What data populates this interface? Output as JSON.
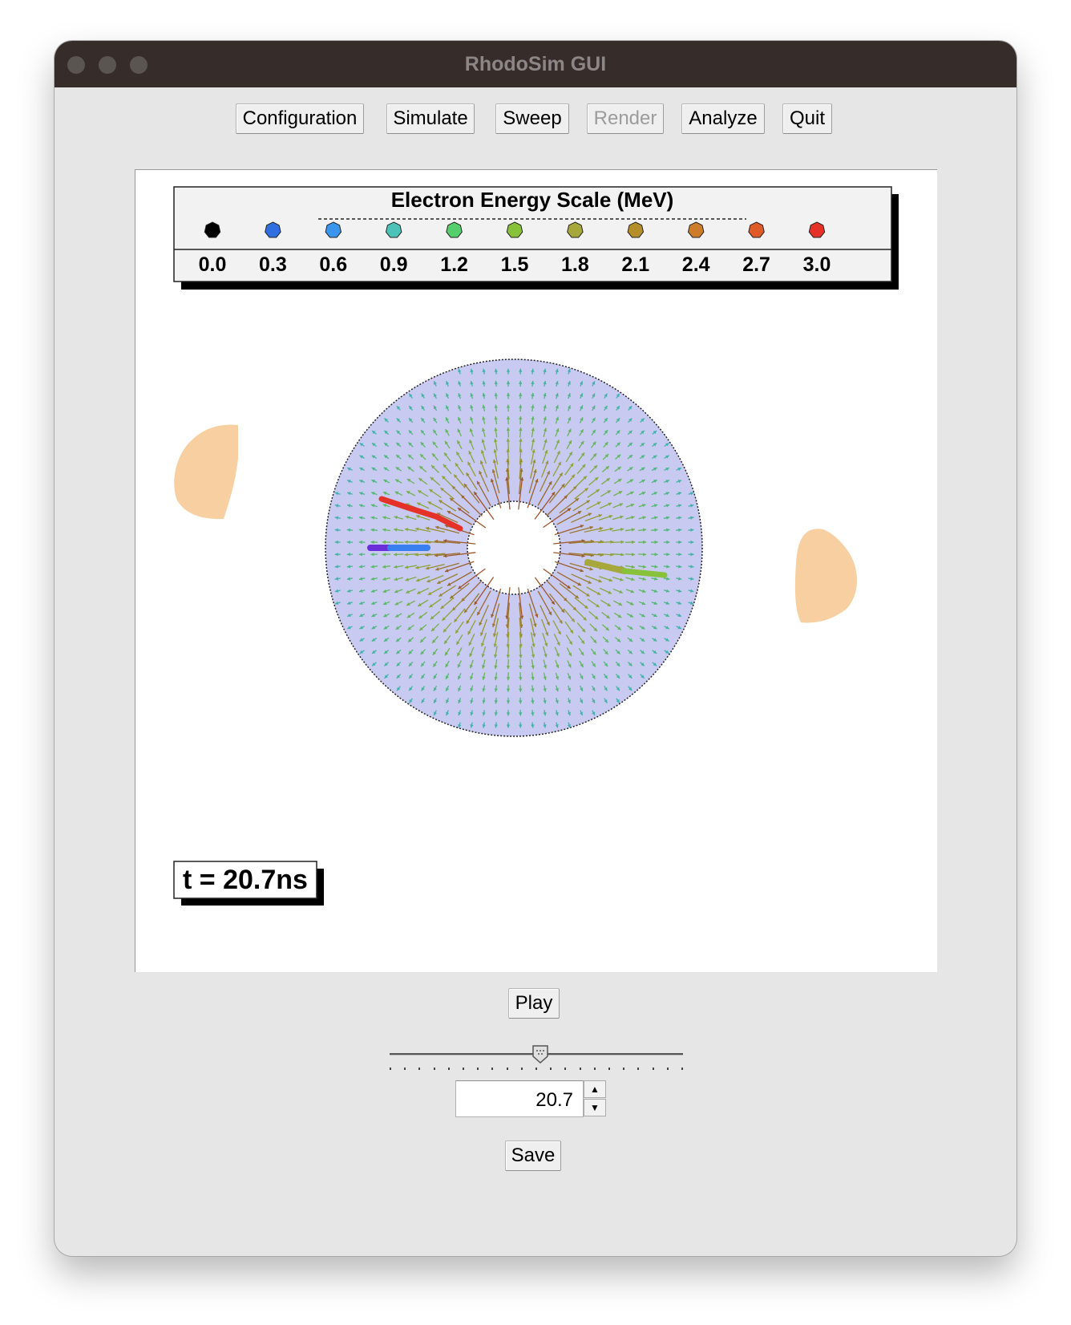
{
  "window": {
    "title": "RhodoSim GUI"
  },
  "toolbar": {
    "configuration": "Configuration",
    "simulate": "Simulate",
    "sweep": "Sweep",
    "render": "Render",
    "analyze": "Analyze",
    "quit": "Quit"
  },
  "legend": {
    "title": "Electron Energy Scale (MeV)",
    "items": [
      {
        "label": "0.0",
        "color": "#000000"
      },
      {
        "label": "0.3",
        "color": "#2f6fe0"
      },
      {
        "label": "0.6",
        "color": "#3a95ec"
      },
      {
        "label": "0.9",
        "color": "#4cc3b8"
      },
      {
        "label": "1.2",
        "color": "#55cf6b"
      },
      {
        "label": "1.5",
        "color": "#88c23a"
      },
      {
        "label": "1.8",
        "color": "#a6a83b"
      },
      {
        "label": "2.1",
        "color": "#b48e2b"
      },
      {
        "label": "2.4",
        "color": "#cd7d2a"
      },
      {
        "label": "2.7",
        "color": "#df5a27"
      },
      {
        "label": "3.0",
        "color": "#e53228"
      }
    ]
  },
  "simulation": {
    "time_label": "t = 20.7ns",
    "field_color": "#c8caf2",
    "magnet_color": "#f7cfa1"
  },
  "controls": {
    "play": "Play",
    "slider_fraction": 0.5,
    "time_value": "20.7",
    "save": "Save"
  }
}
